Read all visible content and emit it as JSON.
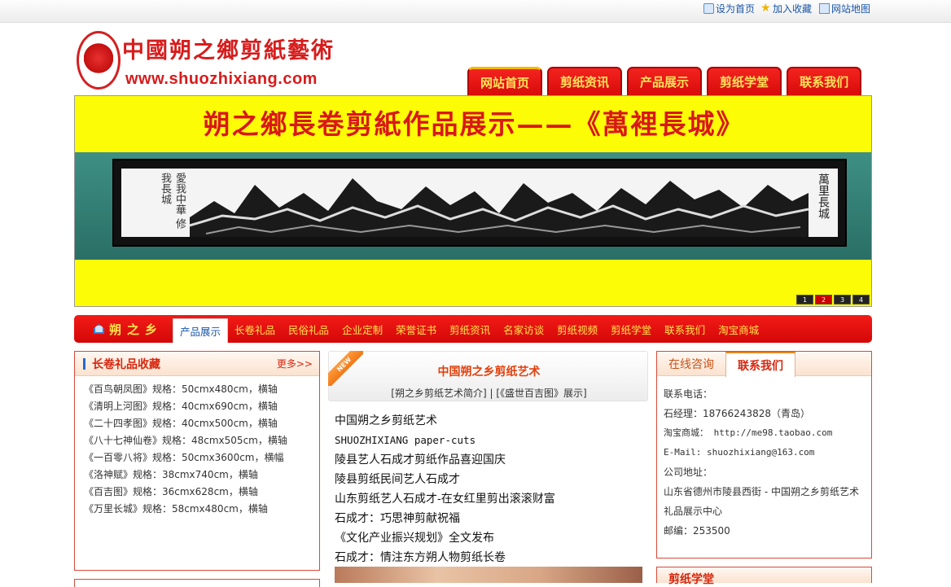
{
  "topbar": {
    "links": [
      "设为首页",
      "加入收藏",
      "网站地图"
    ],
    "icons": [
      "home-icon",
      "star-icon",
      "sitemap-icon"
    ]
  },
  "logo": {
    "title": "中國朔之鄉剪紙藝術",
    "url": "www.shuozhixiang.com"
  },
  "mainnav": [
    "网站首页",
    "剪纸资讯",
    "产品展示",
    "剪纸学堂",
    "联系我们"
  ],
  "banner": {
    "title": "朔之鄉長卷剪紙作品展示——《萬裡長城》",
    "scroll_left_calligraphy": "愛我中華 修我長城",
    "scroll_right_calligraphy": "萬里長城",
    "pager": [
      "1",
      "2",
      "3",
      "4"
    ],
    "active_page": "2"
  },
  "catnav": {
    "brand": "朔之乡",
    "items": [
      "产品展示",
      "长卷礼品",
      "民俗礼品",
      "企业定制",
      "荣誉证书",
      "剪纸资讯",
      "名家访谈",
      "剪纸视频",
      "剪纸学堂",
      "联系我们",
      "淘宝商城"
    ],
    "active": "产品展示"
  },
  "left": {
    "title": "长卷礼品收藏",
    "more": "更多>>",
    "items": [
      "《百鸟朝凤图》规格：50cmx480cm，横轴",
      "《清明上河图》规格：40cmx690cm，横轴",
      "《二十四孝图》规格：40cmx500cm，横轴",
      "《八十七神仙卷》规格：48cmx505cm，横轴",
      "《一百零八将》规格：50cmx3600cm，横幅",
      "《洛神赋》规格：38cmx740cm，横轴",
      "《百吉图》规格：36cmx628cm，横轴",
      "《万里长城》规格：58cmx480cm，横轴"
    ]
  },
  "middle": {
    "badge": "NEW",
    "title": "中国朔之乡剪纸艺术",
    "sub": "[朔之乡剪纸艺术简介] | [《盛世百吉图》展示]",
    "items": [
      "中国朔之乡剪纸艺术",
      "SHUOZHIXIANG paper-cuts",
      "陵县艺人石成才剪纸作品喜迎国庆",
      "陵县剪纸民间艺人石成才",
      "山东剪纸艺人石成才-在女红里剪出滚滚财富",
      "石成才：巧思神剪献祝福",
      "《文化产业振兴规划》全文发布",
      "石成才：情注东方朔人物剪纸长卷"
    ]
  },
  "right": {
    "tabs": [
      "在线咨询",
      "联系我们"
    ],
    "active_tab": "联系我们",
    "contact": [
      "联系电话：",
      "石经理：18766243828（青岛）",
      "淘宝商城： http://me98.taobao.com",
      "E-Mail: shuozhixiang@163.com",
      "公司地址：",
      "山东省德州市陵县西街 - 中国朔之乡剪纸艺术",
      "礼品展示中心",
      "邮编：253500"
    ],
    "next_title": "剪纸学堂"
  },
  "colors": {
    "brand_red": "#d80b0b",
    "nav_text": "#ffe44d",
    "banner_bg": "#fdfc07",
    "link_blue": "#1a56a8"
  }
}
